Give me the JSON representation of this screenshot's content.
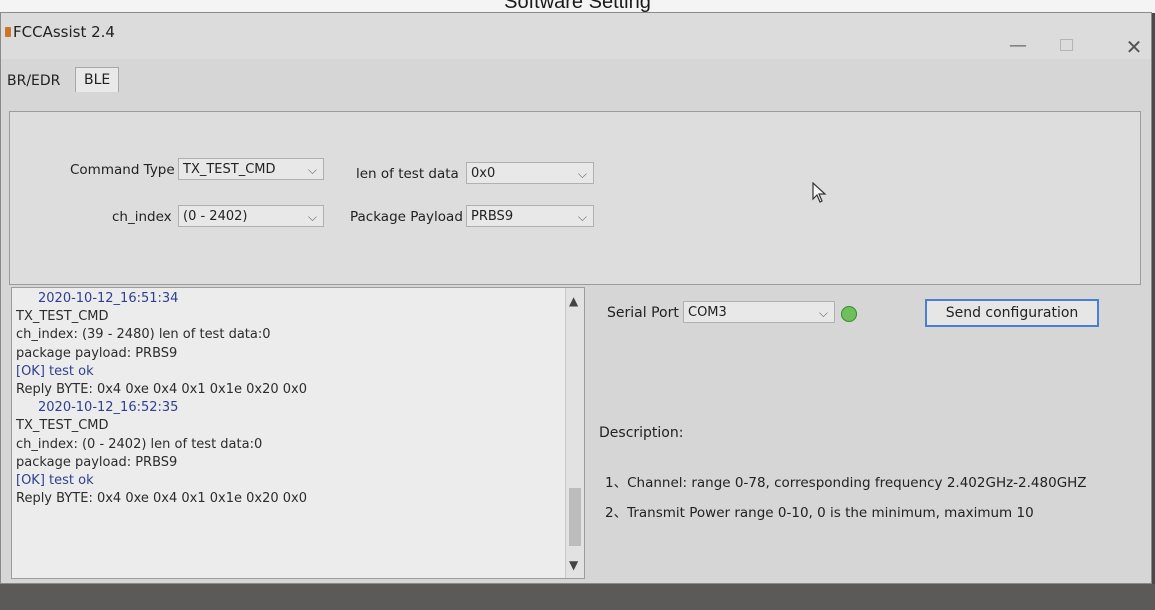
{
  "caption": "Software Setting",
  "window": {
    "title": "FCCAssist 2.4",
    "minimize_glyph": "—",
    "close_glyph": "✕"
  },
  "tabs": [
    {
      "label": "BR/EDR"
    },
    {
      "label": "BLE",
      "active": true
    }
  ],
  "config": {
    "command_type": {
      "label": "Command Type",
      "value": "TX_TEST_CMD"
    },
    "len_of_test_data": {
      "label": "len of test data",
      "value": "0x0"
    },
    "ch_index": {
      "label": "ch_index",
      "value": "(0 - 2402)"
    },
    "package_payload": {
      "label": "Package Payload",
      "value": "PRBS9"
    }
  },
  "log": {
    "lines": [
      {
        "text": "2020-10-12_16:51:34",
        "kind": "ts"
      },
      {
        "text": "TX_TEST_CMD",
        "kind": "plain"
      },
      {
        "text": "ch_index: (39 - 2480)  len of test data:0",
        "kind": "plain"
      },
      {
        "text": "package payload: PRBS9",
        "kind": "plain"
      },
      {
        "text": "[OK] test ok",
        "kind": "ok"
      },
      {
        "text": "Reply BYTE: 0x4 0xe 0x4 0x1 0x1e 0x20 0x0",
        "kind": "plain"
      },
      {
        "text": "2020-10-12_16:52:35",
        "kind": "ts"
      },
      {
        "text": "TX_TEST_CMD",
        "kind": "plain"
      },
      {
        "text": "ch_index: (0 - 2402)  len of test data:0",
        "kind": "plain"
      },
      {
        "text": "package payload: PRBS9",
        "kind": "plain"
      },
      {
        "text": "[OK] test ok",
        "kind": "ok"
      },
      {
        "text": "Reply BYTE: 0x4 0xe 0x4 0x1 0x1e 0x20 0x0",
        "kind": "plain"
      }
    ]
  },
  "serial": {
    "label": "Serial Port",
    "value": "COM3"
  },
  "send_button": {
    "label": "Send configuration"
  },
  "description": {
    "title": "Description:",
    "items": [
      "1、Channel: range 0-78, corresponding frequency 2.402GHz-2.480GHZ",
      "2、Transmit Power  range 0-10, 0 is the minimum, maximum 10"
    ]
  },
  "colors": {
    "accent_border": "#4a7fd4",
    "log_highlight": "#2f3f8f",
    "signal_green": "#6fbf5a"
  }
}
